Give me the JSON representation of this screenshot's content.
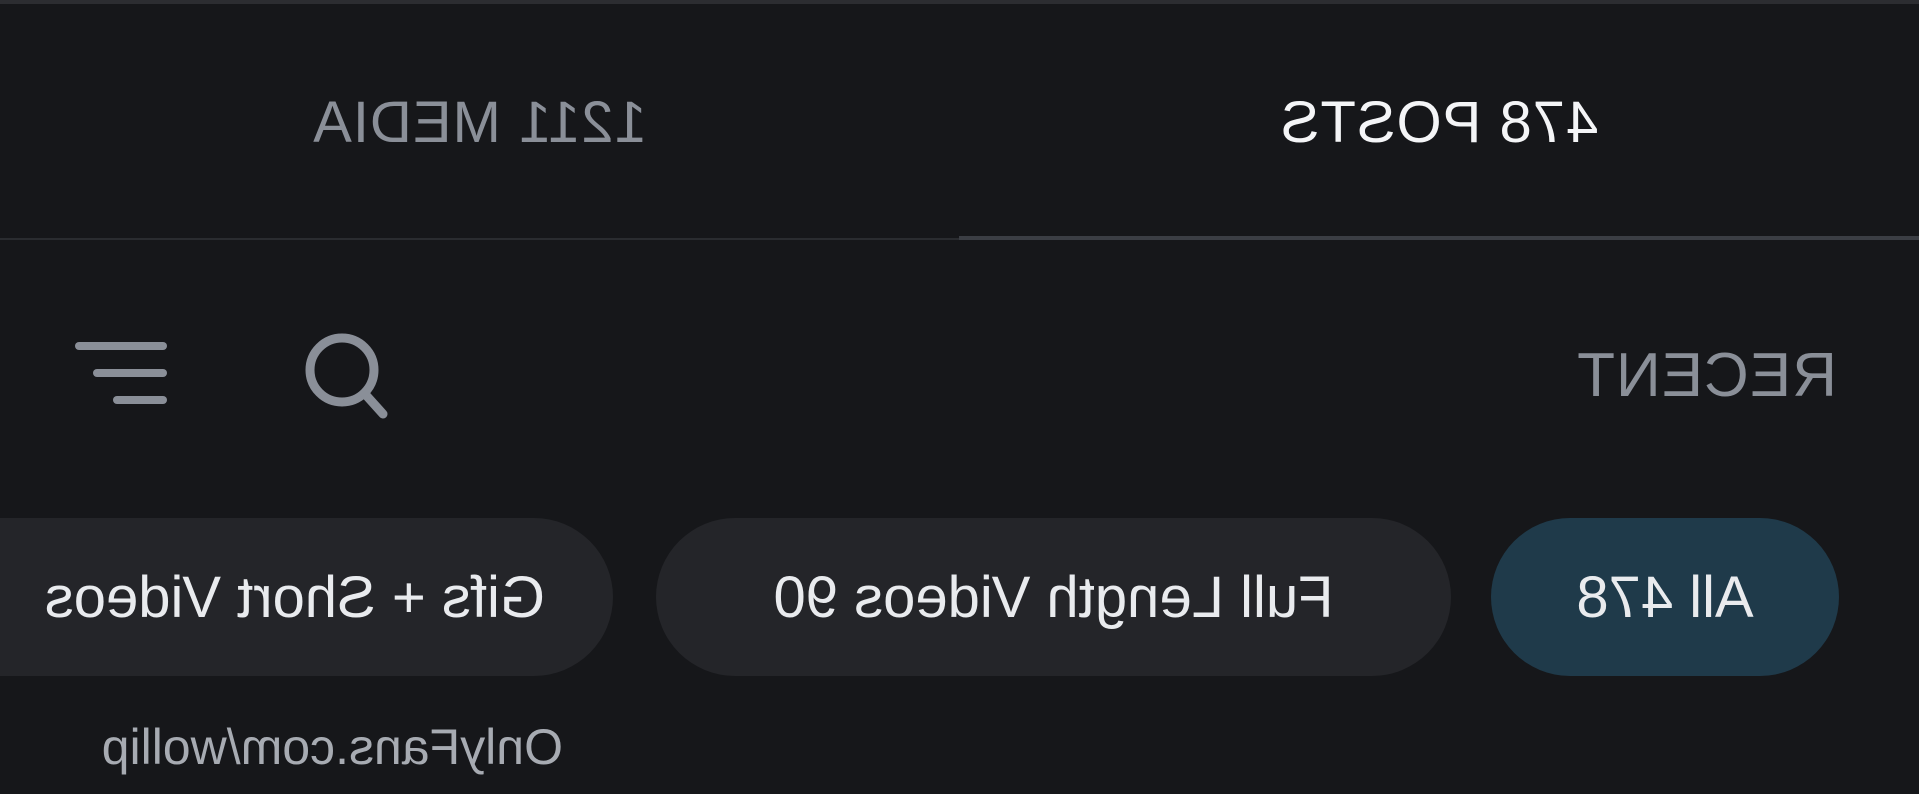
{
  "tabs": [
    {
      "label": "478 POSTS",
      "active": true
    },
    {
      "label": "1211 MEDIA",
      "active": false
    }
  ],
  "toolbar": {
    "sort_label": "RECENT",
    "search_icon": "search-icon",
    "filter_icon": "filter-icon"
  },
  "chips": [
    {
      "label": "All 478",
      "selected": true
    },
    {
      "label": "Full Length Videos 90",
      "selected": false
    },
    {
      "label": "Gifs + Short Videos",
      "selected": false
    }
  ],
  "watermark": "OnlyFans.com/wollip",
  "display": {
    "mirrored_horizontally": true
  },
  "colors": {
    "background": "#16171a",
    "active_text": "#f4f5f7",
    "muted_text": "#8a8f98",
    "chip_selected": "#1f3a4a",
    "chip_default": "#242529"
  }
}
